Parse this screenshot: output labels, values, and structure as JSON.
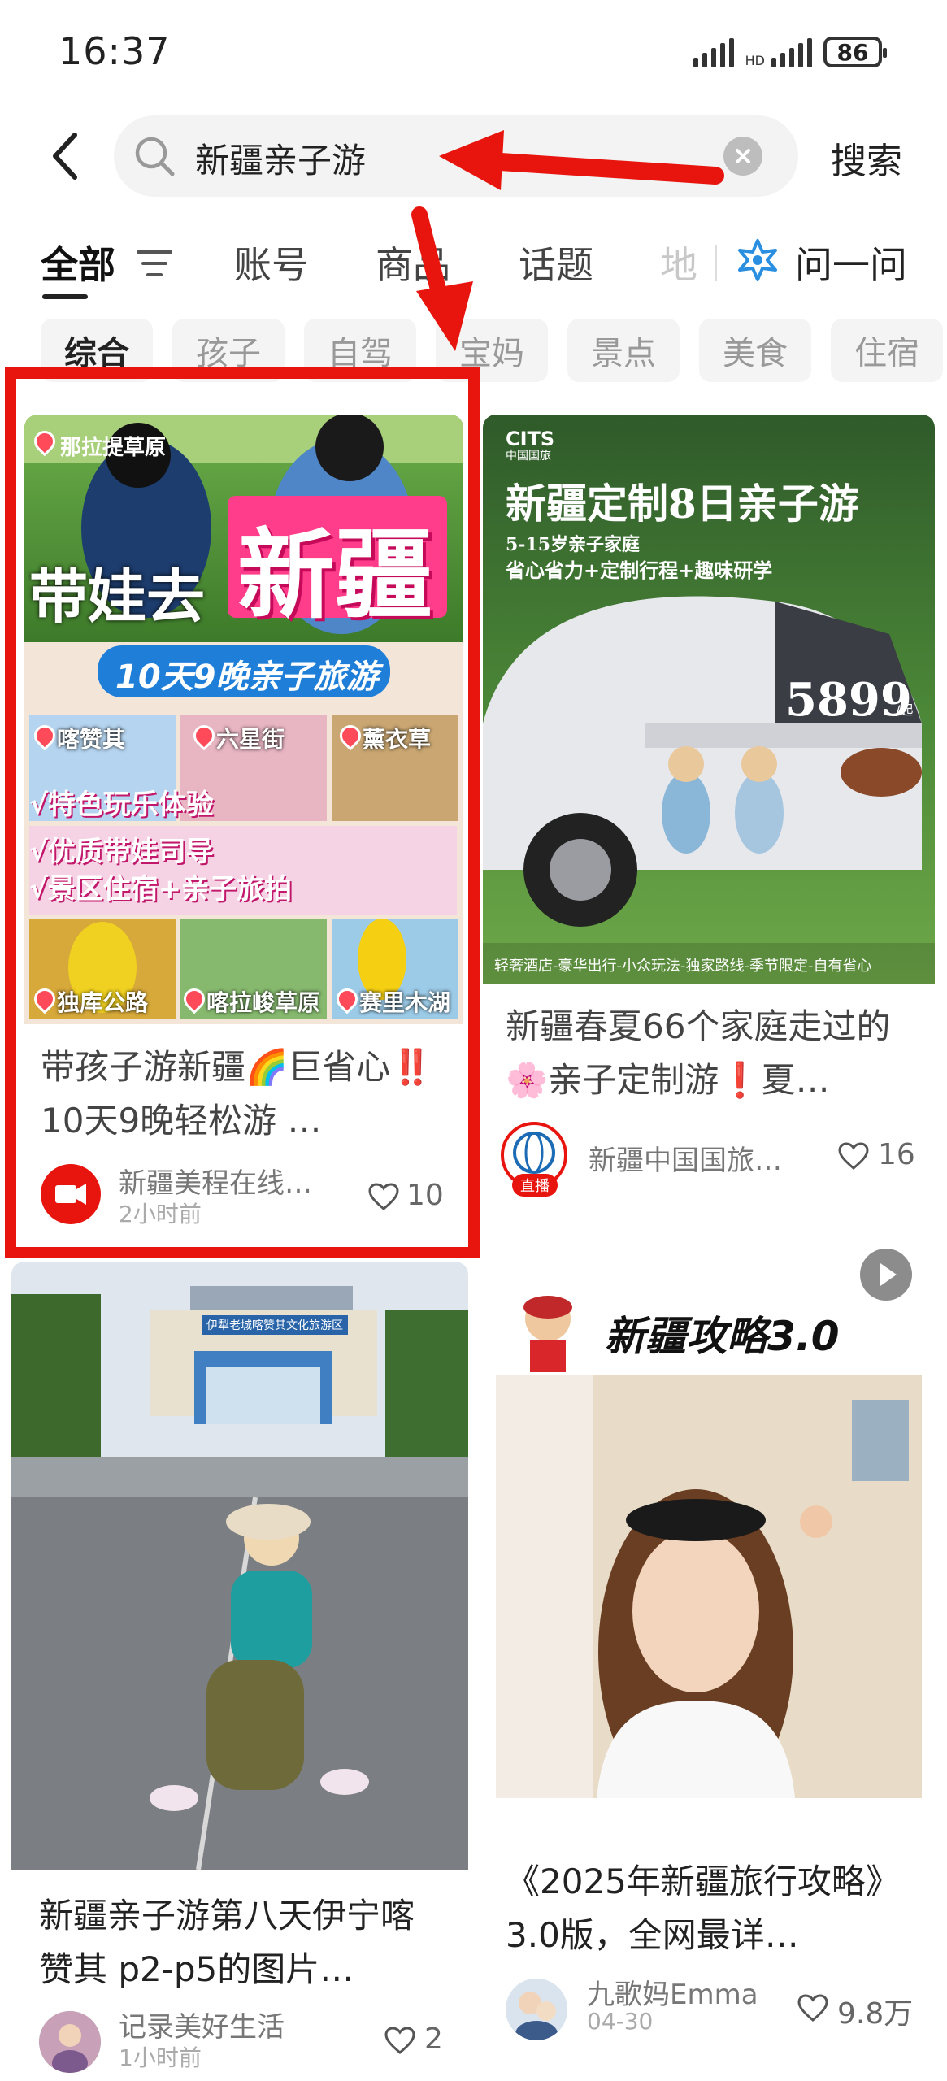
{
  "status_bar": {
    "time": "16:37",
    "battery": "86",
    "network": "HD",
    "icons": [
      "signal-icon",
      "signal-icon",
      "battery-icon"
    ]
  },
  "search": {
    "query": "新疆亲子游",
    "submit_label": "搜索",
    "icons": [
      "back-arrow-icon",
      "search-icon",
      "clear-icon"
    ]
  },
  "tabs": {
    "items": [
      "全部",
      "账号",
      "商品",
      "话题",
      "地"
    ],
    "active": "全部",
    "ask_label": "问一问",
    "icons": [
      "filter-icon",
      "ask-ai-icon"
    ]
  },
  "chips": {
    "items": [
      "综合",
      "孩子",
      "自驾",
      "宝妈",
      "景点",
      "美食",
      "住宿"
    ],
    "active": "综合"
  },
  "cards": [
    {
      "overlay": {
        "place_tag": "那拉提草原",
        "headline_1": "带娃去",
        "headline_2": "新疆",
        "banner": "10天9晚亲子旅游",
        "locations": [
          "喀赞其",
          "六星街",
          "薰衣草",
          "独库公路",
          "喀拉峻草原",
          "赛里木湖"
        ],
        "features": [
          "√特色玩乐体验",
          "√优质带娃司导",
          "√景区住宿+亲子旅拍"
        ]
      },
      "title": "带孩子游新疆🌈巨省心‼️10天9晚轻松游 …",
      "author": "新疆美程在线…",
      "time": "2小时前",
      "likes": "10"
    },
    {
      "overlay": {
        "brand": "CITS",
        "brand_sub": "中国国旅",
        "headline": "新疆定制8日亲子游",
        "sub_1": "5-15岁亲子家庭",
        "sub_2": "省心省力+定制行程+趣味研学",
        "price": "5899",
        "price_unit": "/起",
        "footer": "轻奢酒店-豪华出行-小众玩法-独家路线-季节限定-自有省心"
      },
      "title": "新疆春夏66个家庭走过的🌸亲子定制游❗夏…",
      "author": "新疆中国国旅…",
      "live_badge": "直播",
      "likes": "16"
    },
    {
      "overlay": {
        "gate_sign": "伊犁老城喀赞其文化旅游区"
      },
      "title": "新疆亲子游第八天伊宁喀赞其 p2-p5的图片…",
      "author": "记录美好生活",
      "time": "1小时前",
      "likes": "2"
    },
    {
      "overlay": {
        "headline": "新疆攻略3.0"
      },
      "title": "《2025年新疆旅行攻略》3.0版，全网最详…",
      "author": "九歌妈Emma",
      "time": "04-30",
      "likes": "9.8万"
    }
  ],
  "colors": {
    "accent_red": "#e8150f",
    "like_gray": "#666666",
    "chip_bg": "#f4f4f4",
    "search_bg": "#f3f3f3"
  }
}
